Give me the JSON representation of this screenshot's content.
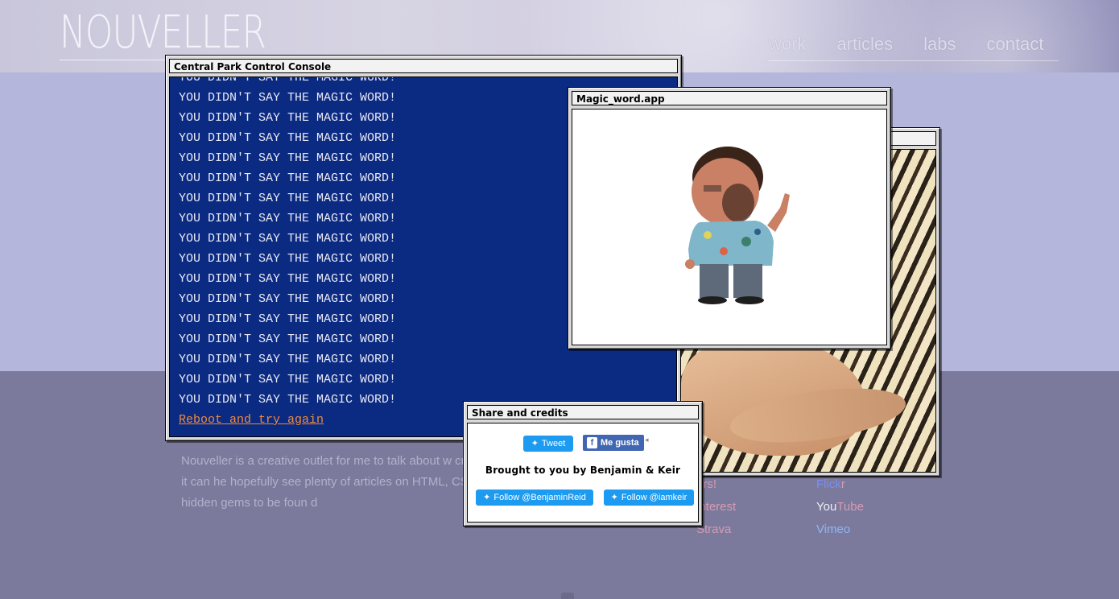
{
  "site": {
    "logo": "NOUVELLER",
    "nav": [
      "work",
      "articles",
      "labs",
      "contact"
    ]
  },
  "about": {
    "text": "Nouveller is a creative outlet for me to talk about w create. I like sharing what I learn, in hope it can he hopefully see plenty of articles on HTML, CSS, Java plenty of experiments and hidden gems to be foun d"
  },
  "social": {
    "col1": [
      "ers!",
      "interest",
      "Strava"
    ],
    "col2": [
      {
        "parts": [
          "Flick",
          "r"
        ]
      },
      {
        "parts": [
          "You",
          "Tube"
        ]
      },
      {
        "parts": [
          "Vimeo"
        ]
      }
    ]
  },
  "console": {
    "title": "Central Park Control Console",
    "line": "YOU DIDN'T SAY THE MAGIC WORD!",
    "line_count": 17,
    "reboot": "Reboot and try again"
  },
  "magic_window": {
    "title": "Magic_word.app"
  },
  "share_window": {
    "title": "Share and credits",
    "tweet": "Tweet",
    "like": "Me gusta",
    "credits": "Brought to you by Benjamin & Keir",
    "follow1": "Follow @BenjaminReid",
    "follow2": "Follow @iamkeir"
  },
  "colors": {
    "console_bg": "#0b2b82",
    "reboot_link": "#f08a3a",
    "twitter": "#1d9bf0",
    "facebook": "#4267b2"
  }
}
